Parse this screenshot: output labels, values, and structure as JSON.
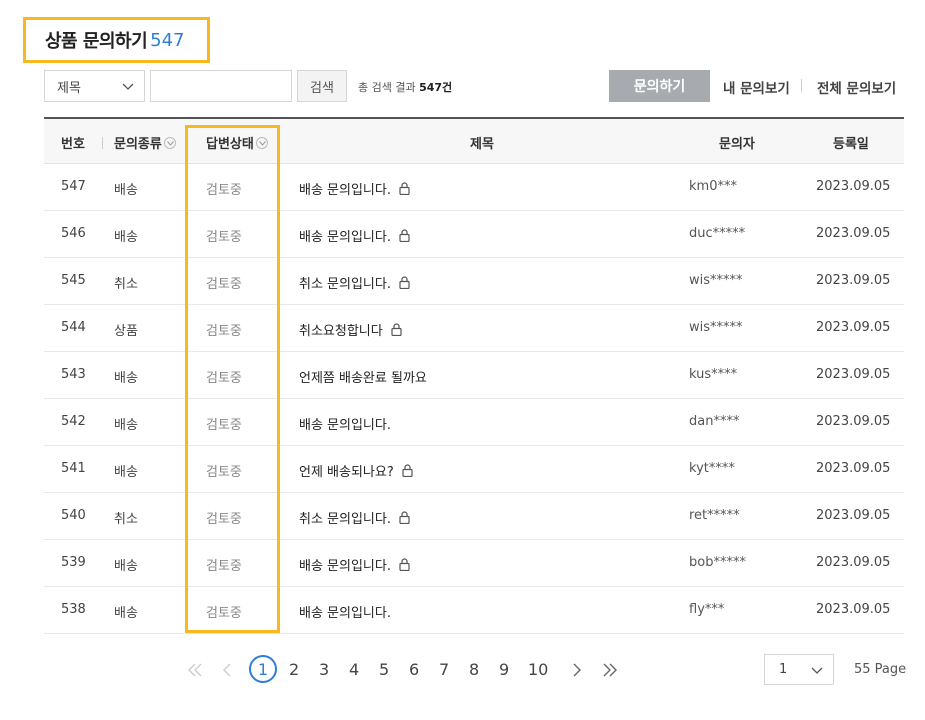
{
  "header": {
    "title": "상품 문의하기",
    "count": "547"
  },
  "toolbar": {
    "search_field_select": "제목",
    "search_input_value": "",
    "search_button": "검색",
    "result_prefix": "총 검색 결과",
    "result_count": "547건",
    "ask_button": "문의하기",
    "my_inquiries": "내 문의보기",
    "all_inquiries": "전체 문의보기"
  },
  "table": {
    "columns": {
      "no": "번호",
      "type": "문의종류",
      "status": "답변상태",
      "title": "제목",
      "user": "문의자",
      "date": "등록일"
    },
    "rows": [
      {
        "no": "547",
        "type": "배송",
        "status": "검토중",
        "title": "배송 문의입니다.",
        "locked": true,
        "user": "km0***",
        "date": "2023.09.05"
      },
      {
        "no": "546",
        "type": "배송",
        "status": "검토중",
        "title": "배송 문의입니다.",
        "locked": true,
        "user": "duc*****",
        "date": "2023.09.05"
      },
      {
        "no": "545",
        "type": "취소",
        "status": "검토중",
        "title": "취소 문의입니다.",
        "locked": true,
        "user": "wis*****",
        "date": "2023.09.05"
      },
      {
        "no": "544",
        "type": "상품",
        "status": "검토중",
        "title": "취소요청합니다",
        "locked": true,
        "user": "wis*****",
        "date": "2023.09.05"
      },
      {
        "no": "543",
        "type": "배송",
        "status": "검토중",
        "title": "언제쯤 배송완료 될까요",
        "locked": false,
        "user": "kus****",
        "date": "2023.09.05"
      },
      {
        "no": "542",
        "type": "배송",
        "status": "검토중",
        "title": "배송 문의입니다.",
        "locked": false,
        "user": "dan****",
        "date": "2023.09.05"
      },
      {
        "no": "541",
        "type": "배송",
        "status": "검토중",
        "title": "언제 배송되나요?",
        "locked": true,
        "user": "kyt****",
        "date": "2023.09.05"
      },
      {
        "no": "540",
        "type": "취소",
        "status": "검토중",
        "title": "취소 문의입니다.",
        "locked": true,
        "user": "ret*****",
        "date": "2023.09.05"
      },
      {
        "no": "539",
        "type": "배송",
        "status": "검토중",
        "title": "배송 문의입니다.",
        "locked": true,
        "user": "bob*****",
        "date": "2023.09.05"
      },
      {
        "no": "538",
        "type": "배송",
        "status": "검토중",
        "title": "배송 문의입니다.",
        "locked": false,
        "user": "fly***",
        "date": "2023.09.05"
      }
    ]
  },
  "pagination": {
    "current": "1",
    "pages": [
      "1",
      "2",
      "3",
      "4",
      "5",
      "6",
      "7",
      "8",
      "9",
      "10"
    ],
    "page_select_value": "1",
    "total_pages": "55 Page"
  },
  "colors": {
    "highlight": "#f9b820",
    "accent": "#2f7fd6",
    "ask_button_bg": "#a7abb0"
  },
  "icons": [
    "chevron-down-icon",
    "sort-toggle-icon",
    "lock-icon",
    "first-page-icon",
    "prev-page-icon",
    "next-page-icon",
    "last-page-icon"
  ]
}
